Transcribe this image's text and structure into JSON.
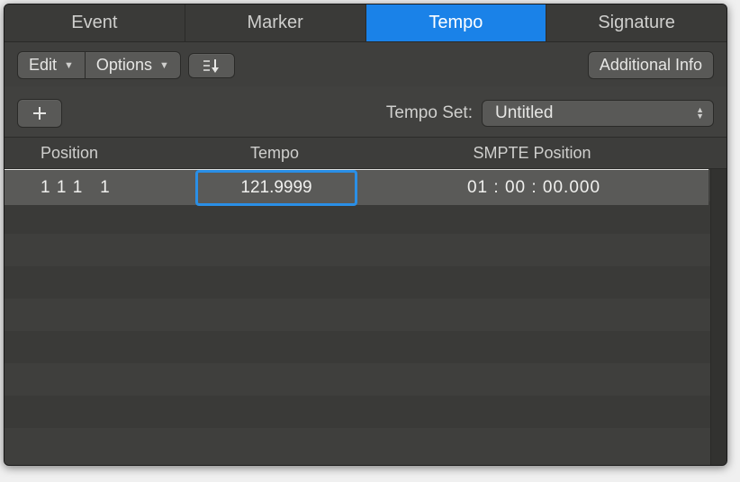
{
  "tabs": {
    "items": [
      {
        "label": "Event",
        "active": false
      },
      {
        "label": "Marker",
        "active": false
      },
      {
        "label": "Tempo",
        "active": true
      },
      {
        "label": "Signature",
        "active": false
      }
    ]
  },
  "toolbar": {
    "edit_label": "Edit",
    "options_label": "Options",
    "additional_info_label": "Additional Info"
  },
  "subbar": {
    "tempo_set_label": "Tempo Set:",
    "tempo_set_value": "Untitled"
  },
  "table": {
    "headers": {
      "position": "Position",
      "tempo": "Tempo",
      "smpte": "SMPTE Position"
    },
    "rows": [
      {
        "position": "1 1 1   1",
        "tempo": "121.9999",
        "smpte": "01 : 00 : 00.000"
      }
    ]
  }
}
